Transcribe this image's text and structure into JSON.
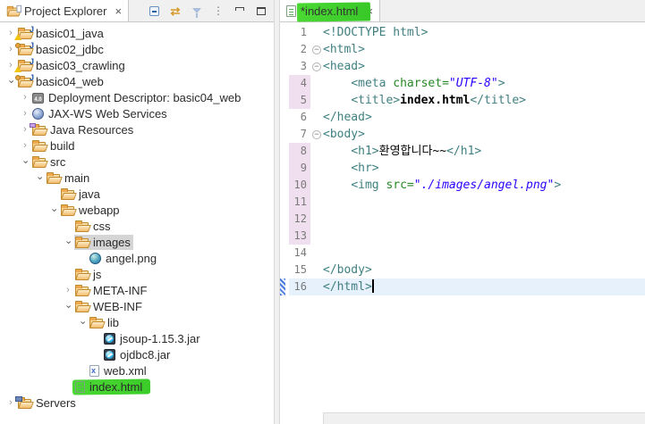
{
  "colors": {
    "green_marker": "#42d32f",
    "tree_selection": "#d5d5d5",
    "syntax_tag": "#3f7f7f",
    "syntax_attribute": "#278727",
    "syntax_value": "#2a00ff",
    "current_line_bg": "#e6f1fc",
    "diff_changed_bg": "#f0dfee"
  },
  "ui": {
    "close_glyph": "×",
    "chevron_glyph": "›",
    "fold_glyph": "−",
    "link_glyph": "⇄",
    "menu_glyph": "⋮"
  },
  "explorer": {
    "tab_label": "Project Explorer",
    "toolbar": [
      {
        "name": "collapse-all"
      },
      {
        "name": "link-with-editor"
      },
      {
        "name": "filter"
      },
      {
        "name": "view-menu"
      },
      {
        "name": "minimize"
      },
      {
        "name": "maximize"
      }
    ],
    "tree": [
      {
        "label": "basic01_java",
        "depth": 0,
        "chevron": "closed",
        "icon": "jproject-warn"
      },
      {
        "label": "basic02_jdbc",
        "depth": 0,
        "chevron": "closed",
        "icon": "jproject-dot"
      },
      {
        "label": "basic03_crawling",
        "depth": 0,
        "chevron": "closed",
        "icon": "jproject-warn"
      },
      {
        "label": "basic04_web",
        "depth": 0,
        "chevron": "open",
        "icon": "jproject-dot"
      },
      {
        "label": "Deployment Descriptor: basic04_web",
        "depth": 1,
        "chevron": "closed",
        "icon": "dd",
        "icon_text": "4.0"
      },
      {
        "label": "JAX-WS Web Services",
        "depth": 1,
        "chevron": "closed",
        "icon": "ws"
      },
      {
        "label": "Java Resources",
        "depth": 1,
        "chevron": "closed",
        "icon": "jres"
      },
      {
        "label": "build",
        "depth": 1,
        "chevron": "closed",
        "icon": "folder"
      },
      {
        "label": "src",
        "depth": 1,
        "chevron": "open",
        "icon": "folder"
      },
      {
        "label": "main",
        "depth": 2,
        "chevron": "open",
        "icon": "folder"
      },
      {
        "label": "java",
        "depth": 3,
        "chevron": "none",
        "icon": "folder"
      },
      {
        "label": "webapp",
        "depth": 3,
        "chevron": "open",
        "icon": "folder"
      },
      {
        "label": "css",
        "depth": 4,
        "chevron": "none",
        "icon": "folder"
      },
      {
        "label": "images",
        "depth": 4,
        "chevron": "open",
        "icon": "folder",
        "selected": true
      },
      {
        "label": "angel.png",
        "depth": 5,
        "chevron": "none",
        "icon": "imgfile"
      },
      {
        "label": "js",
        "depth": 4,
        "chevron": "none",
        "icon": "folder"
      },
      {
        "label": "META-INF",
        "depth": 4,
        "chevron": "closed",
        "icon": "folder"
      },
      {
        "label": "WEB-INF",
        "depth": 4,
        "chevron": "open",
        "icon": "folder"
      },
      {
        "label": "lib",
        "depth": 5,
        "chevron": "open",
        "icon": "folder"
      },
      {
        "label": "jsoup-1.15.3.jar",
        "depth": 6,
        "chevron": "none",
        "icon": "jar"
      },
      {
        "label": "ojdbc8.jar",
        "depth": 6,
        "chevron": "none",
        "icon": "jar"
      },
      {
        "label": "web.xml",
        "depth": 5,
        "chevron": "none",
        "icon": "xml",
        "icon_text": "x"
      },
      {
        "label": "index.html",
        "depth": 4,
        "chevron": "none",
        "icon": "html",
        "marked": true
      },
      {
        "label": "Servers",
        "depth": 0,
        "chevron": "closed",
        "icon": "servers"
      }
    ]
  },
  "editor": {
    "tab_label": "*index.html",
    "lines": [
      {
        "n": 1,
        "tokens": [
          [
            "tag",
            "<!DOCTYPE html>"
          ]
        ]
      },
      {
        "n": 2,
        "fold": true,
        "tokens": [
          [
            "tag",
            "<html>"
          ]
        ]
      },
      {
        "n": 3,
        "fold": true,
        "tokens": [
          [
            "tag",
            "<head>"
          ]
        ]
      },
      {
        "n": 4,
        "diff": true,
        "tokens": [
          [
            "plain",
            "    "
          ],
          [
            "tag",
            "<meta "
          ],
          [
            "attr",
            "charset="
          ],
          [
            "val",
            "\"UTF-8\""
          ],
          [
            "tag",
            ">"
          ]
        ]
      },
      {
        "n": 5,
        "diff": true,
        "tokens": [
          [
            "plain",
            "    "
          ],
          [
            "tag",
            "<title>"
          ],
          [
            "title",
            "index.html"
          ],
          [
            "tag",
            "</title>"
          ]
        ]
      },
      {
        "n": 6,
        "tokens": [
          [
            "tag",
            "</head>"
          ]
        ]
      },
      {
        "n": 7,
        "fold": true,
        "tokens": [
          [
            "tag",
            "<body>"
          ]
        ]
      },
      {
        "n": 8,
        "diff": true,
        "tokens": [
          [
            "plain",
            "    "
          ],
          [
            "tag",
            "<h1>"
          ],
          [
            "text",
            "환영합니다~~"
          ],
          [
            "tag",
            "</h1>"
          ]
        ]
      },
      {
        "n": 9,
        "diff": true,
        "tokens": [
          [
            "plain",
            "    "
          ],
          [
            "tag",
            "<hr>"
          ]
        ]
      },
      {
        "n": 10,
        "diff": true,
        "tokens": [
          [
            "plain",
            "    "
          ],
          [
            "tag",
            "<img "
          ],
          [
            "attr",
            "src="
          ],
          [
            "val",
            "\"./images/angel.png\""
          ],
          [
            "tag",
            ">"
          ]
        ]
      },
      {
        "n": 11,
        "diff": true,
        "tokens": []
      },
      {
        "n": 12,
        "diff": true,
        "tokens": []
      },
      {
        "n": 13,
        "diff": true,
        "tokens": []
      },
      {
        "n": 14,
        "tokens": []
      },
      {
        "n": 15,
        "tokens": [
          [
            "tag",
            "</body>"
          ]
        ]
      },
      {
        "n": 16,
        "added": true,
        "current": true,
        "tokens": [
          [
            "tag",
            "</html>"
          ]
        ]
      }
    ]
  }
}
